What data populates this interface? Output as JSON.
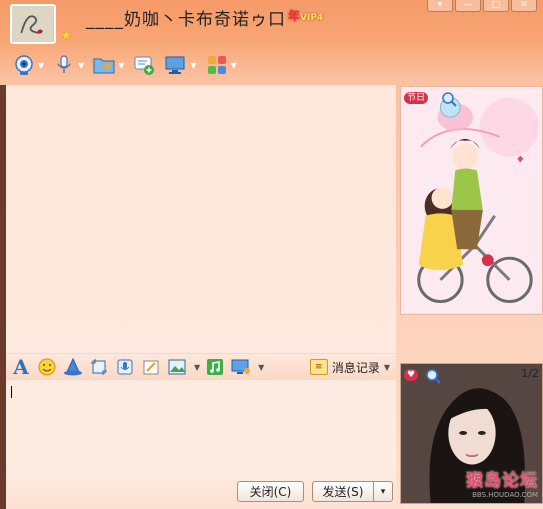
{
  "header": {
    "nickname": "____奶咖丶卡布奇诺ゥ口",
    "vip_label": "VIP4",
    "vip_prefix": "年"
  },
  "window_controls": [
    "▾",
    "—",
    "□",
    "✕"
  ],
  "toolbar": {
    "items": [
      {
        "name": "video-call",
        "icon": "webcam-icon"
      },
      {
        "name": "voice-call",
        "icon": "microphone-icon"
      },
      {
        "name": "send-file",
        "icon": "folder-icon"
      },
      {
        "name": "create-discussion",
        "icon": "chat-add-icon"
      },
      {
        "name": "remote-assist",
        "icon": "monitor-icon"
      },
      {
        "name": "apps",
        "icon": "apps-grid-icon"
      }
    ]
  },
  "partner_panel": {
    "badge": "节日"
  },
  "input_toolbar": {
    "font_label": "A",
    "history_label": "消息记录"
  },
  "my_panel": {
    "page_indicator": "1/2",
    "watermark_main": "猴岛论坛",
    "watermark_sub": "BBS.HOUDAO.COM"
  },
  "buttons": {
    "close": "关闭(C)",
    "send": "发送(S)",
    "send_arrow": "▾"
  },
  "colors": {
    "accent": "#f59a68",
    "chat_bg": "#fde6da",
    "icon_blue": "#2f6fc8"
  }
}
